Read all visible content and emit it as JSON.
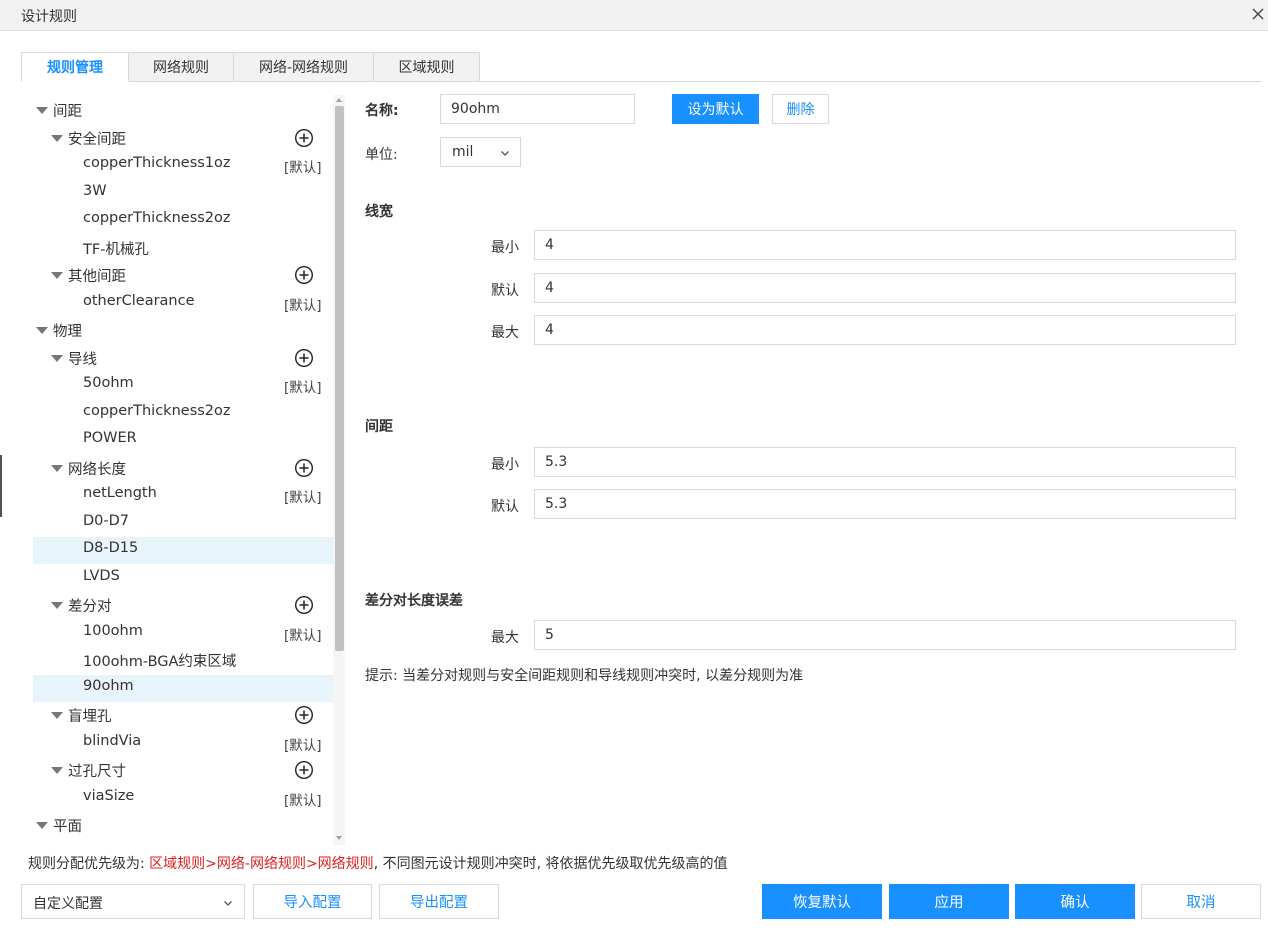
{
  "window": {
    "title": "设计规则"
  },
  "tabs": [
    {
      "label": "规则管理",
      "active": true
    },
    {
      "label": "网络规则",
      "active": false
    },
    {
      "label": "网络-网络规则",
      "active": false
    },
    {
      "label": "区域规则",
      "active": false
    }
  ],
  "tree": {
    "default_badge": "[默认]",
    "nodes": [
      {
        "label": "间距",
        "level": 0,
        "expanded": true
      },
      {
        "label": "安全间距",
        "level": 1,
        "expanded": true,
        "add": true
      },
      {
        "label": "copperThickness1oz",
        "level": 2,
        "default": true
      },
      {
        "label": "3W",
        "level": 2
      },
      {
        "label": "copperThickness2oz",
        "level": 2
      },
      {
        "label": "TF-机械孔",
        "level": 2
      },
      {
        "label": "其他间距",
        "level": 1,
        "expanded": true,
        "add": true
      },
      {
        "label": "otherClearance",
        "level": 2,
        "default": true
      },
      {
        "label": "物理",
        "level": 0,
        "expanded": true
      },
      {
        "label": "导线",
        "level": 1,
        "expanded": true,
        "add": true
      },
      {
        "label": "50ohm",
        "level": 2,
        "default": true
      },
      {
        "label": "copperThickness2oz",
        "level": 2
      },
      {
        "label": "POWER",
        "level": 2
      },
      {
        "label": "网络长度",
        "level": 1,
        "expanded": true,
        "add": true
      },
      {
        "label": "netLength",
        "level": 2,
        "default": true
      },
      {
        "label": "D0-D7",
        "level": 2
      },
      {
        "label": "D8-D15",
        "level": 2,
        "hover": true
      },
      {
        "label": "LVDS",
        "level": 2
      },
      {
        "label": "差分对",
        "level": 1,
        "expanded": true,
        "add": true
      },
      {
        "label": "100ohm",
        "level": 2,
        "default": true
      },
      {
        "label": "100ohm-BGA约束区域",
        "level": 2
      },
      {
        "label": "90ohm",
        "level": 2,
        "selected": true
      },
      {
        "label": "盲埋孔",
        "level": 1,
        "expanded": true,
        "add": true
      },
      {
        "label": "blindVia",
        "level": 2,
        "default": true
      },
      {
        "label": "过孔尺寸",
        "level": 1,
        "expanded": true,
        "add": true
      },
      {
        "label": "viaSize",
        "level": 2,
        "default": true
      },
      {
        "label": "平面",
        "level": 0,
        "expanded": true
      }
    ]
  },
  "form": {
    "name_label": "名称:",
    "name_value": "90ohm",
    "set_default_button": "设为默认",
    "delete_button": "删除",
    "unit_label": "单位:",
    "unit_value": "mil",
    "line_width": {
      "title": "线宽",
      "min_label": "最小",
      "min_value": "4",
      "default_label": "默认",
      "default_value": "4",
      "max_label": "最大",
      "max_value": "4"
    },
    "spacing": {
      "title": "间距",
      "min_label": "最小",
      "min_value": "5.3",
      "default_label": "默认",
      "default_value": "5.3"
    },
    "diff_length": {
      "title": "差分对长度误差",
      "max_label": "最大",
      "max_value": "5"
    },
    "hint": "提示: 当差分对规则与安全间距规则和导线规则冲突时, 以差分规则为准"
  },
  "footer": {
    "priority_prefix": "规则分配优先级为: ",
    "priority_order": "区域规则>网络-网络规则>网络规则",
    "priority_suffix": ", 不同图元设计规则冲突时, 将依据优先级取优先级高的值",
    "config_select": "自定义配置",
    "import_button": "导入配置",
    "export_button": "导出配置",
    "restore_button": "恢复默认",
    "apply_button": "应用",
    "confirm_button": "确认",
    "cancel_button": "取消"
  },
  "colors": {
    "accent": "#1890ff",
    "selected_bg": "#e8f4fc",
    "priority_red": "#e02020"
  },
  "icons": {
    "close": "close-icon",
    "add": "plus-circle-icon",
    "caret": "caret-down-icon",
    "chevron": "chevron-down-icon"
  }
}
